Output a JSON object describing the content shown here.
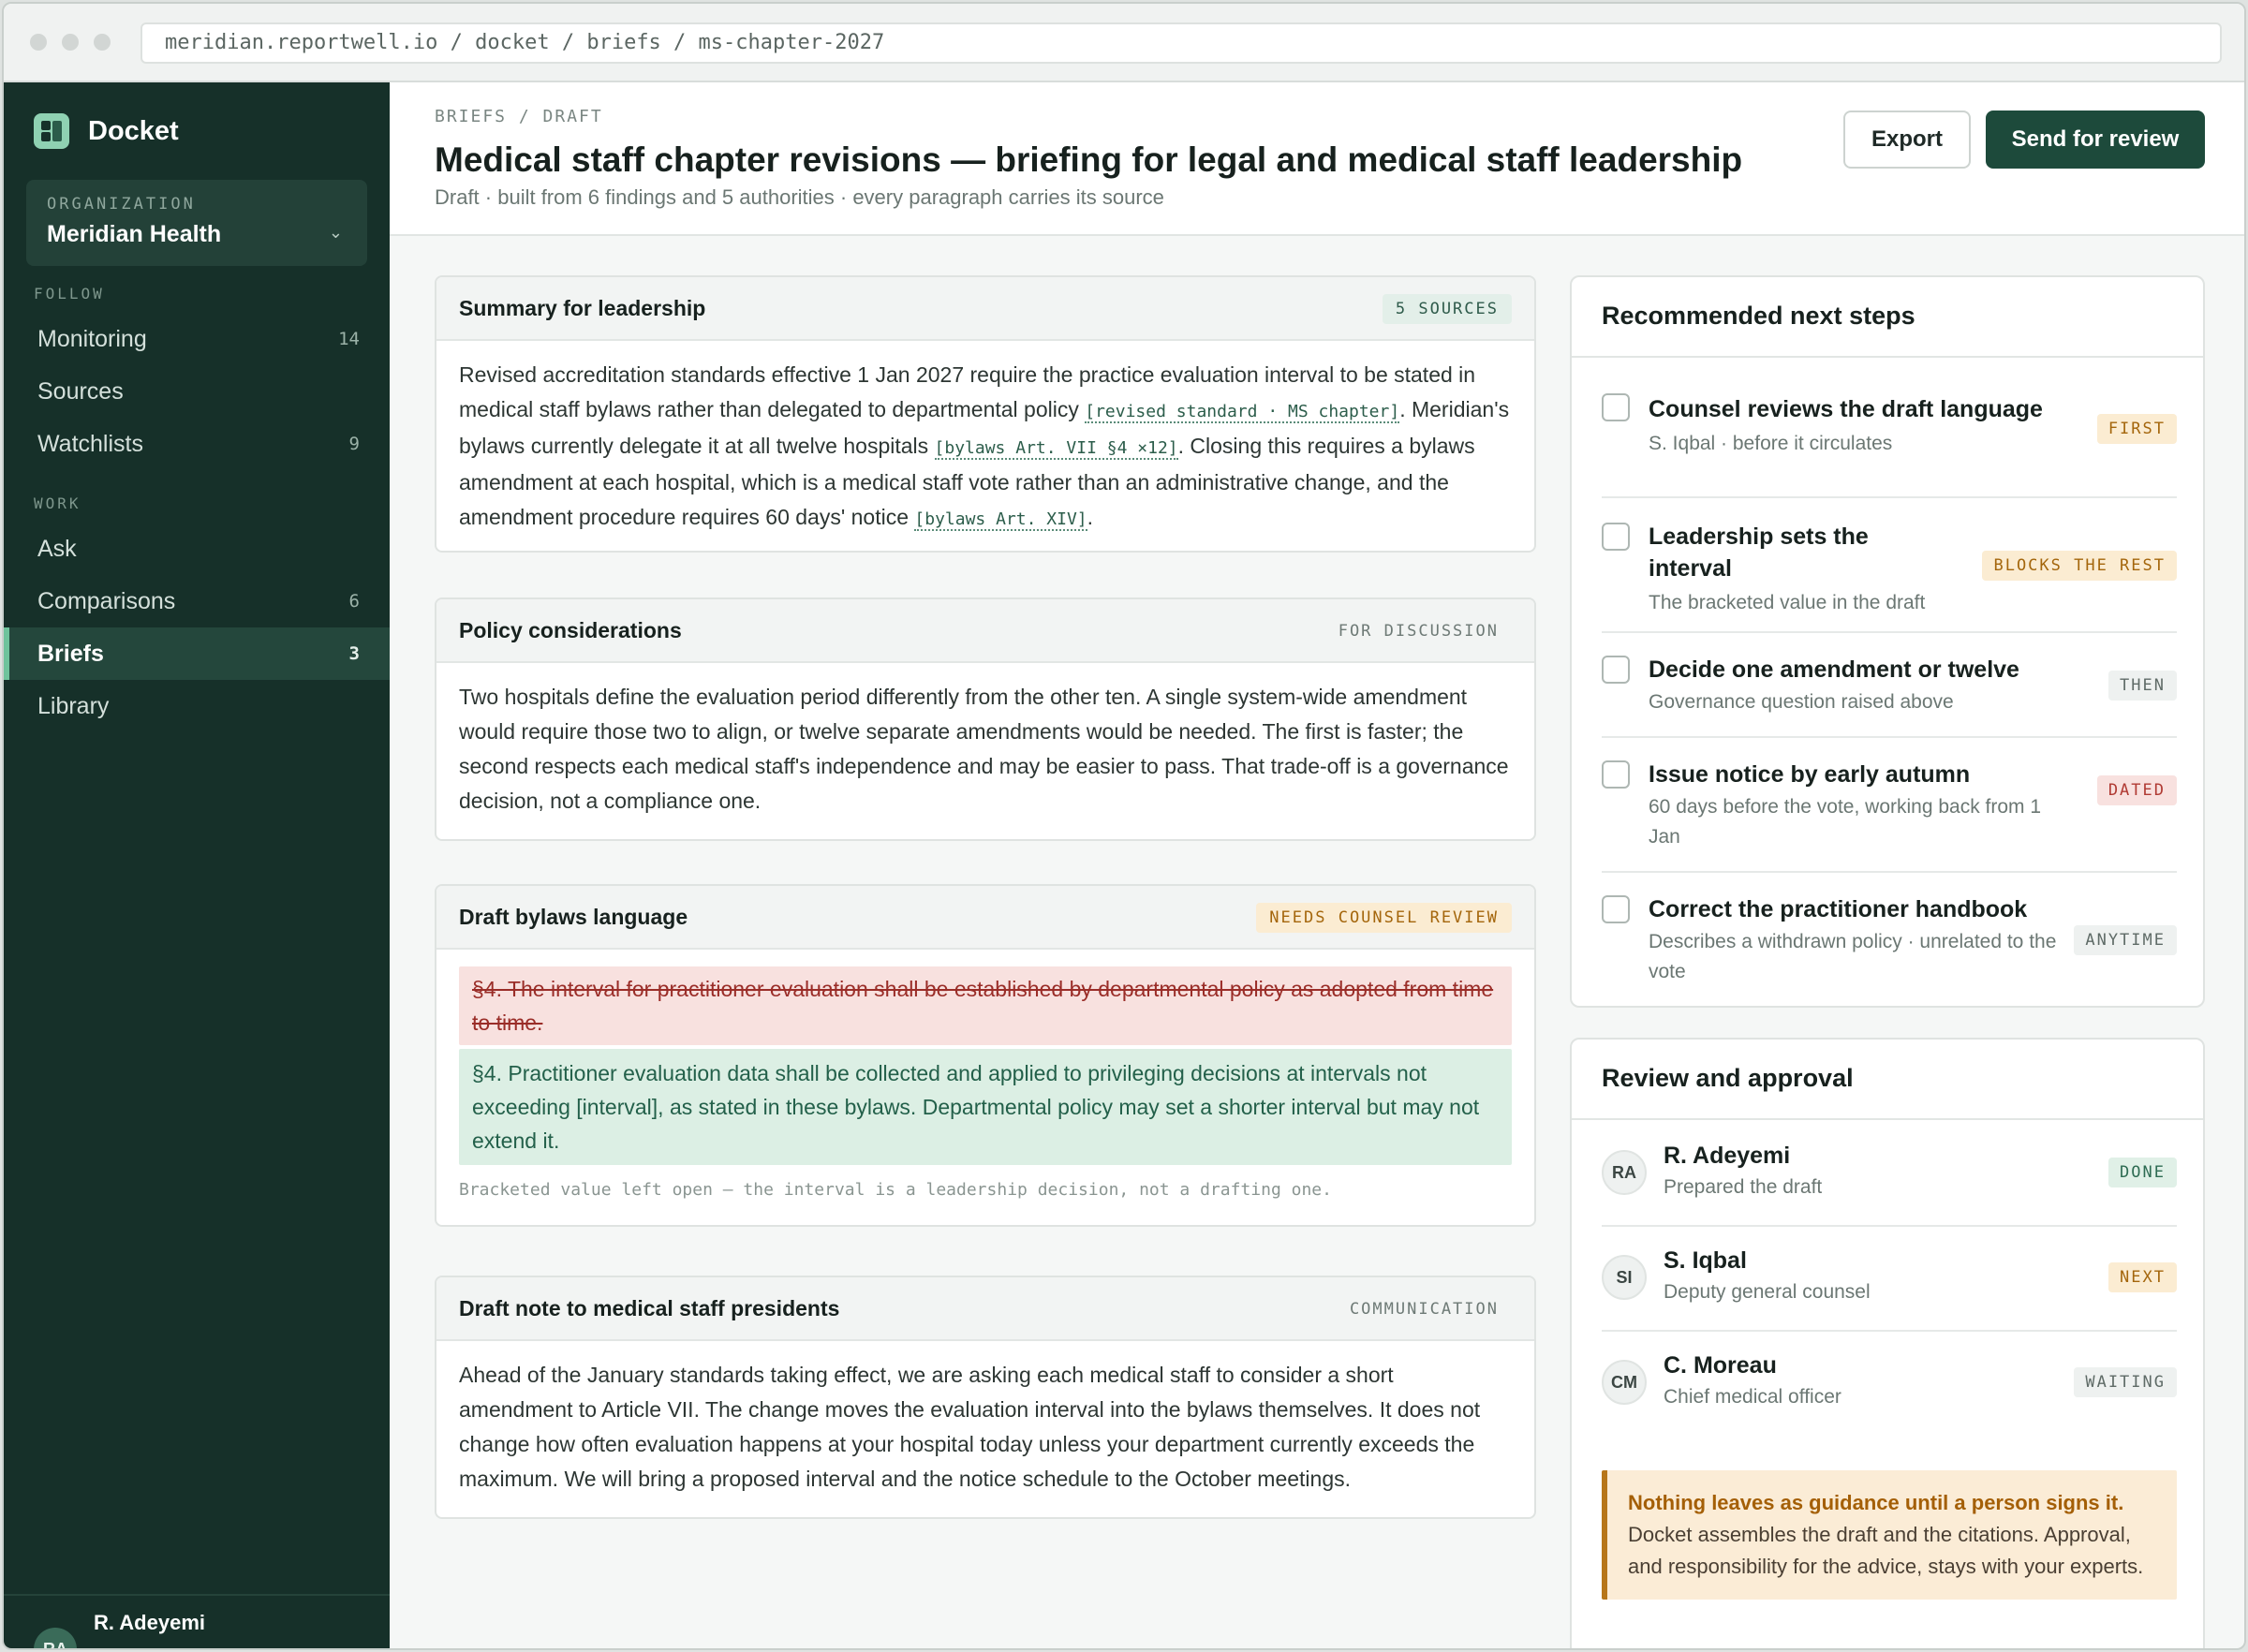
{
  "browser": {
    "url": "meridian.reportwell.io / docket / briefs / ms-chapter-2027"
  },
  "sidebar": {
    "brand": "Docket",
    "org_label": "ORGANIZATION",
    "org_name": "Meridian Health",
    "sections": {
      "follow": "FOLLOW",
      "work": "WORK"
    },
    "items": [
      {
        "label": "Monitoring",
        "count": "14"
      },
      {
        "label": "Sources",
        "count": ""
      },
      {
        "label": "Watchlists",
        "count": "9"
      },
      {
        "label": "Ask",
        "count": ""
      },
      {
        "label": "Comparisons",
        "count": "6"
      },
      {
        "label": "Briefs",
        "count": "3"
      },
      {
        "label": "Library",
        "count": ""
      }
    ],
    "user": {
      "initials": "RA",
      "name": "R. Adeyemi"
    }
  },
  "header": {
    "breadcrumb": "BRIEFS / DRAFT",
    "title": "Medical staff chapter revisions — briefing for legal and medical staff leadership",
    "subtitle": "Draft · built from 6 findings and 5 authorities · every paragraph carries its source",
    "export_label": "Export",
    "send_label": "Send for review"
  },
  "sections": {
    "summary": {
      "title": "Summary for leadership",
      "tag": "5 SOURCES",
      "t1": "Revised accreditation standards effective 1 Jan 2027 require the practice evaluation interval to be stated in medical staff bylaws rather than delegated to departmental policy ",
      "c1": "[revised standard · MS chapter]",
      "t2": ". Meridian's bylaws currently delegate it at all twelve hospitals ",
      "c2": "[bylaws Art. VII §4 ×12]",
      "t3": ". Closing this requires a bylaws amendment at each hospital, which is a medical staff vote rather than an administrative change, and the amendment procedure requires 60 days' notice ",
      "c3": "[bylaws Art. XIV]",
      "t4": "."
    },
    "policy": {
      "title": "Policy considerations",
      "tag": "FOR DISCUSSION",
      "body": "Two hospitals define the evaluation period differently from the other ten. A single system-wide amendment would require those two to align, or twelve separate amendments would be needed. The first is faster; the second respects each medical staff's independence and may be easier to pass. That trade-off is a governance decision, not a compliance one."
    },
    "draft": {
      "title": "Draft bylaws language",
      "tag": "NEEDS COUNSEL REVIEW",
      "deleted": "§4. The interval for practitioner evaluation shall be established by departmental policy as adopted from time to time.",
      "inserted": "§4. Practitioner evaluation data shall be collected and applied to privileging decisions at intervals not exceeding [interval], as stated in these bylaws. Departmental policy may set a shorter interval but may not extend it.",
      "note": "Bracketed value left open — the interval is a leadership decision, not a drafting one."
    },
    "note": {
      "title": "Draft note to medical staff presidents",
      "tag": "COMMUNICATION",
      "body": "Ahead of the January standards taking effect, we are asking each medical staff to consider a short amendment to Article VII. The change moves the evaluation interval into the bylaws themselves. It does not change how often evaluation happens at your hospital today unless your department currently exceeds the maximum. We will bring a proposed interval and the notice schedule to the October meetings."
    }
  },
  "next_steps": {
    "title": "Recommended next steps",
    "items": [
      {
        "title": "Counsel reviews the draft language",
        "sub": "S. Iqbal · before it circulates",
        "badge": "FIRST",
        "checked": false
      },
      {
        "title": "Leadership sets the interval",
        "sub": "The bracketed value in the draft",
        "badge": "BLOCKS THE REST",
        "checked": false
      },
      {
        "title": "Decide one amendment or twelve",
        "sub": "Governance question raised above",
        "badge": "THEN",
        "checked": false
      },
      {
        "title": "Issue notice by early autumn",
        "sub": "60 days before the vote, working back from 1 Jan",
        "badge": "DATED",
        "checked": false
      },
      {
        "title": "Correct the practitioner handbook",
        "sub": "Describes a withdrawn policy · unrelated to the vote",
        "badge": "ANYTIME",
        "checked": false
      }
    ]
  },
  "approval": {
    "title": "Review and approval",
    "reviewers": [
      {
        "initials": "RA",
        "name": "R. Adeyemi",
        "role": "Prepared the draft",
        "status": "DONE"
      },
      {
        "initials": "SI",
        "name": "S. Iqbal",
        "role": "Deputy general counsel",
        "status": "NEXT"
      },
      {
        "initials": "CM",
        "name": "C. Moreau",
        "role": "Chief medical officer",
        "status": "WAITING"
      }
    ],
    "callout_strong": "Nothing leaves as guidance until a person signs it.",
    "callout_body": "Docket assembles the draft and the citations. Approval, and responsibility for the advice, stays with your experts."
  },
  "colors": {
    "sidebar_bg": "#163029",
    "accent": "#1d4a3b",
    "amber": "#a4660c",
    "red": "#b03a33",
    "green": "#2d6b52"
  }
}
